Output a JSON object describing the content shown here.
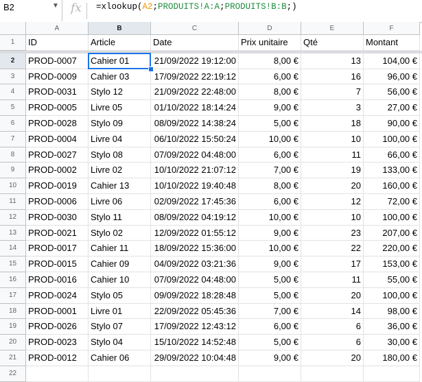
{
  "namebox": {
    "value": "B2"
  },
  "formula_bar": {
    "fx": "fx",
    "parts": [
      "=xlookup(",
      "A2",
      ";",
      "PRODUITS!A:A",
      ";",
      "PRODUITS!B:B",
      ";)"
    ]
  },
  "columns": [
    "A",
    "B",
    "C",
    "D",
    "E",
    "F"
  ],
  "row_numbers": [
    "1",
    "2",
    "3",
    "4",
    "5",
    "6",
    "7",
    "8",
    "9",
    "10",
    "11",
    "12",
    "13",
    "14",
    "15",
    "16",
    "17",
    "18",
    "19",
    "20",
    "21",
    "22"
  ],
  "headers": [
    "ID",
    "Article",
    "Date",
    "Prix unitaire",
    "Qté",
    "Montant"
  ],
  "rows": [
    [
      "PROD-0007",
      "Cahier 01",
      "21/09/2022 19:12:00",
      "8,00 €",
      "13",
      "104,00 €"
    ],
    [
      "PROD-0009",
      "Cahier 03",
      "17/09/2022 22:19:12",
      "6,00 €",
      "16",
      "96,00 €"
    ],
    [
      "PROD-0031",
      "Stylo 12",
      "21/09/2022 22:48:00",
      "8,00 €",
      "7",
      "56,00 €"
    ],
    [
      "PROD-0005",
      "Livre 05",
      "01/10/2022 18:14:24",
      "9,00 €",
      "3",
      "27,00 €"
    ],
    [
      "PROD-0028",
      "Stylo 09",
      "08/09/2022 14:38:24",
      "5,00 €",
      "18",
      "90,00 €"
    ],
    [
      "PROD-0004",
      "Livre 04",
      "06/10/2022 15:50:24",
      "10,00 €",
      "10",
      "100,00 €"
    ],
    [
      "PROD-0027",
      "Stylo 08",
      "07/09/2022 04:48:00",
      "6,00 €",
      "11",
      "66,00 €"
    ],
    [
      "PROD-0002",
      "Livre 02",
      "10/10/2022 21:07:12",
      "7,00 €",
      "19",
      "133,00 €"
    ],
    [
      "PROD-0019",
      "Cahier 13",
      "10/10/2022 19:40:48",
      "8,00 €",
      "20",
      "160,00 €"
    ],
    [
      "PROD-0006",
      "Livre 06",
      "02/09/2022 17:45:36",
      "6,00 €",
      "12",
      "72,00 €"
    ],
    [
      "PROD-0030",
      "Stylo 11",
      "08/09/2022 04:19:12",
      "10,00 €",
      "10",
      "100,00 €"
    ],
    [
      "PROD-0021",
      "Stylo 02",
      "12/09/2022 01:55:12",
      "9,00 €",
      "23",
      "207,00 €"
    ],
    [
      "PROD-0017",
      "Cahier 11",
      "18/09/2022 15:36:00",
      "10,00 €",
      "22",
      "220,00 €"
    ],
    [
      "PROD-0015",
      "Cahier 09",
      "04/09/2022 03:21:36",
      "9,00 €",
      "17",
      "153,00 €"
    ],
    [
      "PROD-0016",
      "Cahier 10",
      "07/09/2022 04:48:00",
      "5,00 €",
      "11",
      "55,00 €"
    ],
    [
      "PROD-0024",
      "Stylo 05",
      "09/09/2022 18:28:48",
      "5,00 €",
      "20",
      "100,00 €"
    ],
    [
      "PROD-0001",
      "Livre 01",
      "22/09/2022 05:45:36",
      "7,00 €",
      "14",
      "98,00 €"
    ],
    [
      "PROD-0026",
      "Stylo 07",
      "17/09/2022 12:43:12",
      "6,00 €",
      "6",
      "36,00 €"
    ],
    [
      "PROD-0023",
      "Stylo 04",
      "15/10/2022 14:52:48",
      "5,00 €",
      "6",
      "30,00 €"
    ],
    [
      "PROD-0012",
      "Cahier 06",
      "29/09/2022 10:04:48",
      "9,00 €",
      "20",
      "180,00 €"
    ],
    [
      "",
      "",
      "",
      "",
      "",
      ""
    ]
  ],
  "selected": {
    "column": "B",
    "row": "2"
  }
}
